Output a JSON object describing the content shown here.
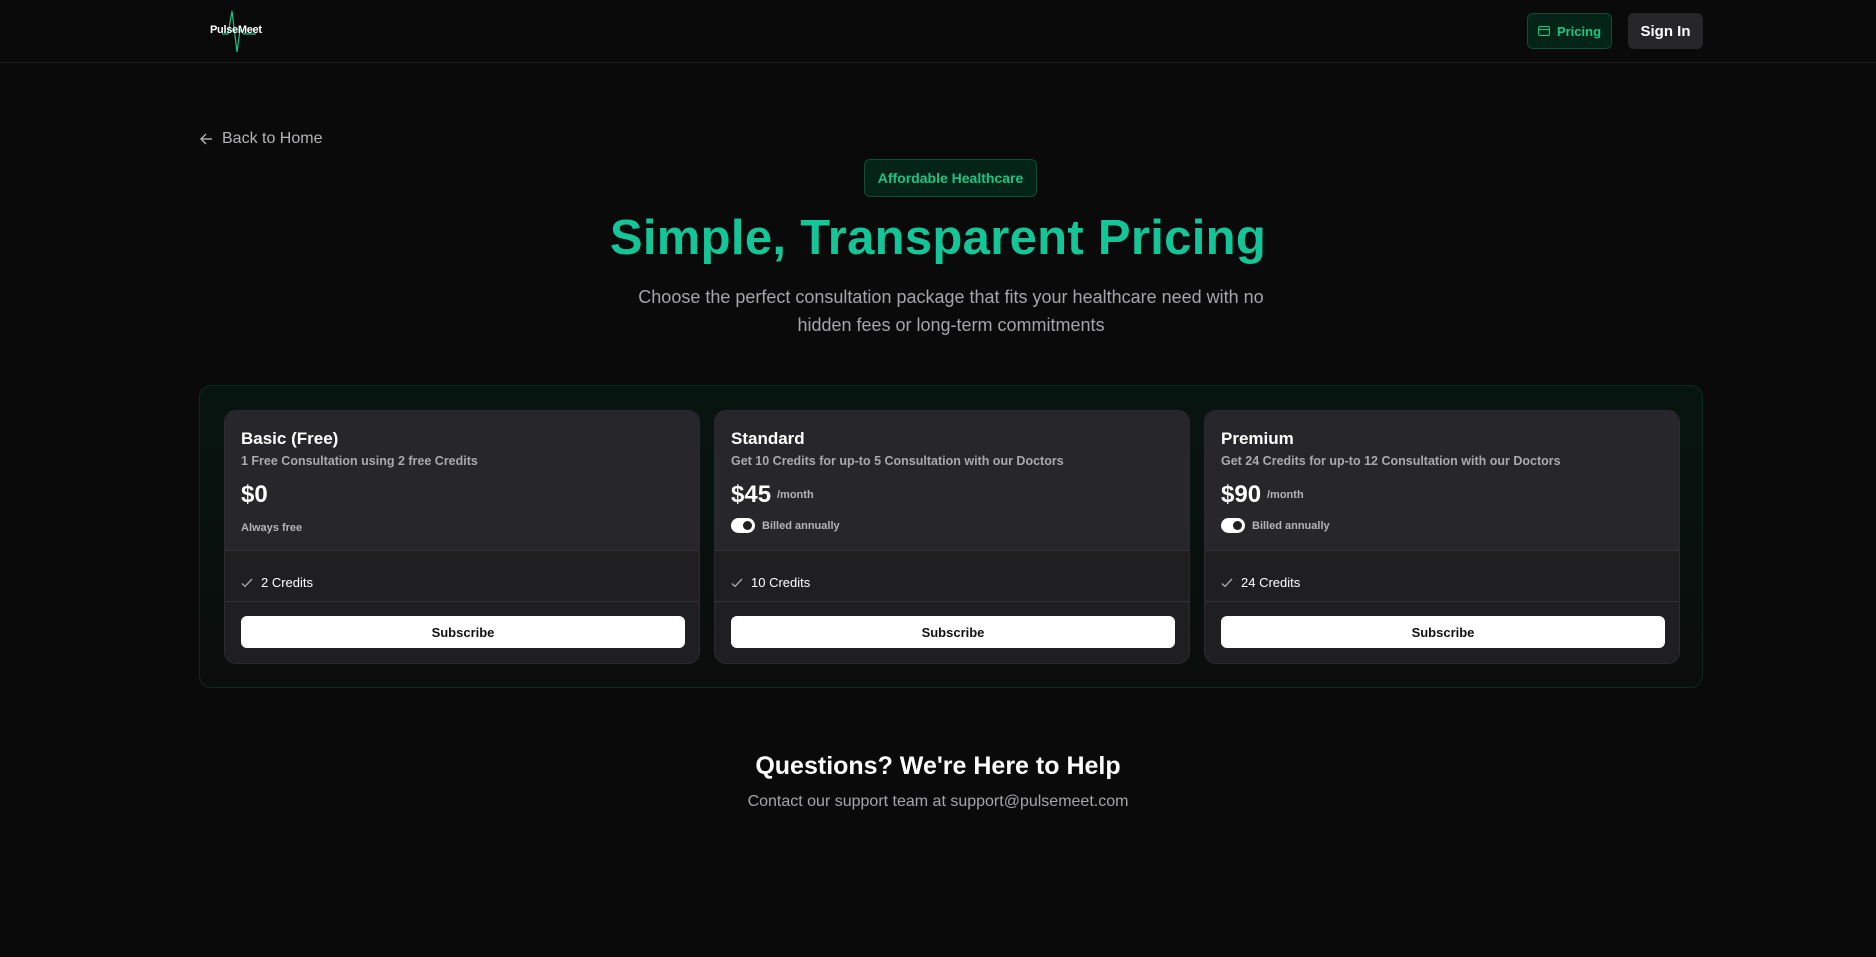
{
  "header": {
    "logo_text": "PulseMeet",
    "pricing_label": "Pricing",
    "signin_label": "Sign In"
  },
  "back_link": {
    "label": "Back to Home"
  },
  "hero": {
    "badge": "Affordable Healthcare",
    "title": "Simple, Transparent Pricing",
    "subtitle": "Choose the perfect consultation package that fits your healthcare need with no hidden fees or long-term commitments"
  },
  "plans": [
    {
      "name": "Basic (Free)",
      "description": "1 Free Consultation using 2 free Credits",
      "price": "$0",
      "period": "",
      "note": "Always free",
      "billed_label": "",
      "feature": "2 Credits",
      "cta": "Subscribe"
    },
    {
      "name": "Standard",
      "description": "Get 10 Credits for up-to 5 Consultation with our Doctors",
      "price": "$45",
      "period": "/month",
      "note": "",
      "billed_label": "Billed annually",
      "feature": "10 Credits",
      "cta": "Subscribe"
    },
    {
      "name": "Premium",
      "description": "Get 24 Credits for up-to 12 Consultation with our Doctors",
      "price": "$90",
      "period": "/month",
      "note": "",
      "billed_label": "Billed annually",
      "feature": "24 Credits",
      "cta": "Subscribe"
    }
  ],
  "help": {
    "title": "Questions? We're Here to Help",
    "subtitle": "Contact our support team at support@pulsemeet.com"
  },
  "colors": {
    "accent": "#13c597",
    "accent_dark_bg": "#052418",
    "background": "#0a0a0a",
    "card": "#1f1f22"
  },
  "icons": {
    "logo": "pulse-wave-icon",
    "pricing": "credit-card-icon",
    "back": "arrow-left-icon",
    "feature": "check-icon"
  }
}
